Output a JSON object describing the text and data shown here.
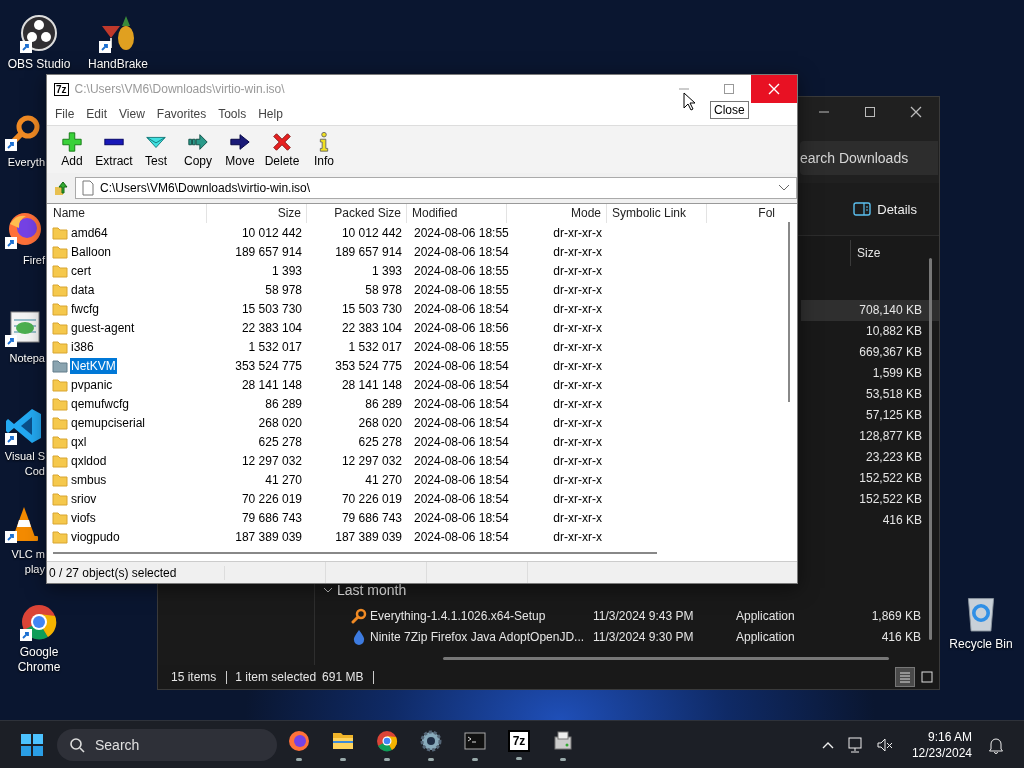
{
  "desktop_icons": [
    {
      "kind": "obs",
      "label": "OBS Studio"
    },
    {
      "kind": "everything",
      "label": "Everyth"
    },
    {
      "kind": "firefox",
      "label": "Firef"
    },
    {
      "kind": "notepad",
      "label": "Notepa"
    },
    {
      "kind": "vscode",
      "label": "Visual S\nCod"
    },
    {
      "kind": "vlc",
      "label": "VLC m\nplay"
    },
    {
      "kind": "chrome",
      "label": "Google Chrome"
    },
    {
      "kind": "handbrake",
      "label": "HandBrake"
    }
  ],
  "recycle_bin": {
    "label": "Recycle Bin"
  },
  "explorer": {
    "search": {
      "placeholder": "earch Downloads"
    },
    "details_button": "Details",
    "size_column": "Size",
    "rows": [
      {
        "size": "708,140 KB",
        "selected": true
      },
      {
        "size": "10,882 KB",
        "selected": false
      },
      {
        "size": "669,367 KB",
        "selected": false
      },
      {
        "size": "1,599 KB",
        "selected": false
      },
      {
        "size": "53,518 KB",
        "selected": false
      },
      {
        "size": "57,125 KB",
        "selected": false
      },
      {
        "size": "128,877 KB",
        "selected": false
      },
      {
        "size": "23,223 KB",
        "selected": false
      },
      {
        "size": "152,522 KB",
        "selected": false
      },
      {
        "size": "152,522 KB",
        "selected": false
      },
      {
        "size": "416 KB",
        "selected": false
      }
    ],
    "group": {
      "label": "Last month",
      "expanded": true,
      "rows": [
        {
          "kind": "magnifier",
          "name": "Everything-1.4.1.1026.x64-Setup",
          "date": "11/3/2024 9:43 PM",
          "type": "Application",
          "size": "1,869 KB"
        },
        {
          "kind": "installer",
          "name": "Ninite 7Zip Firefox Java AdoptOpenJD...",
          "date": "11/3/2024 9:30 PM",
          "type": "Application",
          "size": "416 KB"
        }
      ]
    },
    "status": {
      "items": "15 items",
      "selection": "1 item selected",
      "selection_size": "691 MB"
    },
    "view_modes": [
      {
        "kind": "details",
        "selected": true
      },
      {
        "kind": "tiles",
        "selected": false
      }
    ]
  },
  "sevenzip": {
    "logo": "7z",
    "title": "C:\\Users\\VM6\\Downloads\\virtio-win.iso\\",
    "menu": [
      "File",
      "Edit",
      "View",
      "Favorites",
      "Tools",
      "Help"
    ],
    "toolbar": [
      {
        "kind": "add",
        "label": "Add"
      },
      {
        "kind": "extract",
        "label": "Extract"
      },
      {
        "kind": "test",
        "label": "Test"
      },
      {
        "kind": "copy",
        "label": "Copy"
      },
      {
        "kind": "move",
        "label": "Move"
      },
      {
        "kind": "delete",
        "label": "Delete"
      },
      {
        "kind": "info",
        "label": "Info"
      }
    ],
    "path": "C:\\Users\\VM6\\Downloads\\virtio-win.iso\\",
    "columns": [
      "Name",
      "Size",
      "Packed Size",
      "Modified",
      "Mode",
      "Symbolic Link",
      "Fol"
    ],
    "rows": [
      {
        "name": "amd64",
        "size": "10 012 442",
        "packed": "10 012 442",
        "modified": "2024-08-06 18:55",
        "mode": "dr-xr-xr-x",
        "selected": false
      },
      {
        "name": "Balloon",
        "size": "189 657 914",
        "packed": "189 657 914",
        "modified": "2024-08-06 18:54",
        "mode": "dr-xr-xr-x",
        "selected": false
      },
      {
        "name": "cert",
        "size": "1 393",
        "packed": "1 393",
        "modified": "2024-08-06 18:55",
        "mode": "dr-xr-xr-x",
        "selected": false
      },
      {
        "name": "data",
        "size": "58 978",
        "packed": "58 978",
        "modified": "2024-08-06 18:55",
        "mode": "dr-xr-xr-x",
        "selected": false
      },
      {
        "name": "fwcfg",
        "size": "15 503 730",
        "packed": "15 503 730",
        "modified": "2024-08-06 18:54",
        "mode": "dr-xr-xr-x",
        "selected": false
      },
      {
        "name": "guest-agent",
        "size": "22 383 104",
        "packed": "22 383 104",
        "modified": "2024-08-06 18:56",
        "mode": "dr-xr-xr-x",
        "selected": false
      },
      {
        "name": "i386",
        "size": "1 532 017",
        "packed": "1 532 017",
        "modified": "2024-08-06 18:55",
        "mode": "dr-xr-xr-x",
        "selected": false
      },
      {
        "name": "NetKVM",
        "size": "353 524 775",
        "packed": "353 524 775",
        "modified": "2024-08-06 18:54",
        "mode": "dr-xr-xr-x",
        "selected": true
      },
      {
        "name": "pvpanic",
        "size": "28 141 148",
        "packed": "28 141 148",
        "modified": "2024-08-06 18:54",
        "mode": "dr-xr-xr-x",
        "selected": false
      },
      {
        "name": "qemufwcfg",
        "size": "86 289",
        "packed": "86 289",
        "modified": "2024-08-06 18:54",
        "mode": "dr-xr-xr-x",
        "selected": false
      },
      {
        "name": "qemupciserial",
        "size": "268 020",
        "packed": "268 020",
        "modified": "2024-08-06 18:54",
        "mode": "dr-xr-xr-x",
        "selected": false
      },
      {
        "name": "qxl",
        "size": "625 278",
        "packed": "625 278",
        "modified": "2024-08-06 18:54",
        "mode": "dr-xr-xr-x",
        "selected": false
      },
      {
        "name": "qxldod",
        "size": "12 297 032",
        "packed": "12 297 032",
        "modified": "2024-08-06 18:54",
        "mode": "dr-xr-xr-x",
        "selected": false
      },
      {
        "name": "smbus",
        "size": "41 270",
        "packed": "41 270",
        "modified": "2024-08-06 18:54",
        "mode": "dr-xr-xr-x",
        "selected": false
      },
      {
        "name": "sriov",
        "size": "70 226 019",
        "packed": "70 226 019",
        "modified": "2024-08-06 18:54",
        "mode": "dr-xr-xr-x",
        "selected": false
      },
      {
        "name": "viofs",
        "size": "79 686 743",
        "packed": "79 686 743",
        "modified": "2024-08-06 18:54",
        "mode": "dr-xr-xr-x",
        "selected": false
      },
      {
        "name": "viogpudo",
        "size": "187 389 039",
        "packed": "187 389 039",
        "modified": "2024-08-06 18:54",
        "mode": "dr-xr-xr-x",
        "selected": false
      }
    ],
    "status": "0 / 27 object(s) selected",
    "tooltip": "Close"
  },
  "taskbar": {
    "search": {
      "placeholder": "Search"
    },
    "apps": [
      {
        "kind": "firefox",
        "running": true
      },
      {
        "kind": "explorer",
        "running": true
      },
      {
        "kind": "chrome",
        "running": true
      },
      {
        "kind": "settings",
        "running": true
      },
      {
        "kind": "terminal",
        "running": true
      },
      {
        "kind": "sevenzip",
        "label": "7z",
        "running": true
      },
      {
        "kind": "setup",
        "running": true
      }
    ],
    "time": "9:16 AM",
    "date": "12/23/2024"
  }
}
